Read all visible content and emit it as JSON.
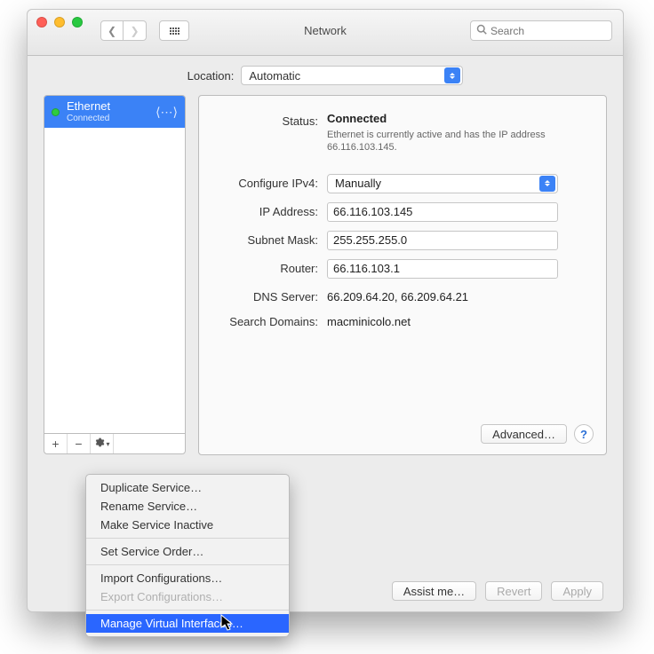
{
  "window": {
    "title": "Network",
    "search_placeholder": "Search"
  },
  "location": {
    "label": "Location:",
    "value": "Automatic"
  },
  "sidebar": {
    "service_name": "Ethernet",
    "service_status": "Connected"
  },
  "detail": {
    "status_label": "Status:",
    "status_value": "Connected",
    "status_desc": "Ethernet is currently active and has the IP address 66.116.103.145.",
    "configure_label": "Configure IPv4:",
    "configure_value": "Manually",
    "ip_label": "IP Address:",
    "ip_value": "66.116.103.145",
    "mask_label": "Subnet Mask:",
    "mask_value": "255.255.255.0",
    "router_label": "Router:",
    "router_value": "66.116.103.1",
    "dns_label": "DNS Server:",
    "dns_value": "66.209.64.20, 66.209.64.21",
    "search_label": "Search Domains:",
    "search_value": "macminicolo.net",
    "advanced": "Advanced…"
  },
  "buttons": {
    "assist": "Assist me…",
    "revert": "Revert",
    "apply": "Apply"
  },
  "menu": {
    "duplicate": "Duplicate Service…",
    "rename": "Rename Service…",
    "inactive": "Make Service Inactive",
    "order": "Set Service Order…",
    "import": "Import Configurations…",
    "export": "Export Configurations…",
    "manage": "Manage Virtual Interfaces…"
  }
}
